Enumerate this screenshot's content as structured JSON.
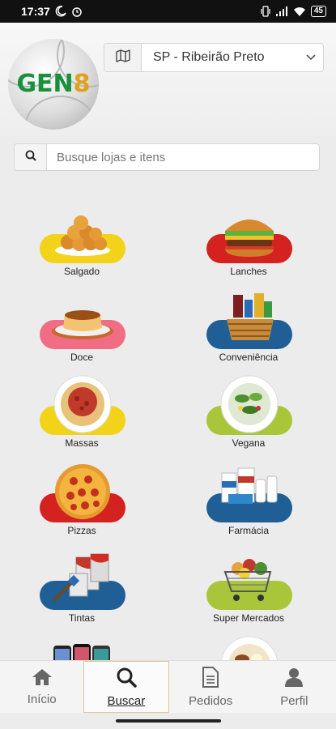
{
  "status": {
    "time": "17:37",
    "battery": "45"
  },
  "logo": {
    "text_a": "GEN",
    "text_b": "8"
  },
  "city": {
    "selected": "SP - Ribeirão Preto"
  },
  "search": {
    "placeholder": "Busque lojas e itens",
    "value": ""
  },
  "categories": [
    {
      "label": "Salgado",
      "color": "#f3d21a"
    },
    {
      "label": "Lanches",
      "color": "#d3221f"
    },
    {
      "label": "Doce",
      "color": "#f06d83"
    },
    {
      "label": "Conveniência",
      "color": "#1f5f95"
    },
    {
      "label": "Massas",
      "color": "#f3d21a"
    },
    {
      "label": "Vegana",
      "color": "#a9c63b"
    },
    {
      "label": "Pizzas",
      "color": "#d3221f"
    },
    {
      "label": "Farmácia",
      "color": "#1f5f95"
    },
    {
      "label": "Tintas",
      "color": "#1f5f95"
    },
    {
      "label": "Super Mercados",
      "color": "#a9c63b"
    },
    {
      "label": "",
      "color": "#1f5f95"
    },
    {
      "label": "",
      "color": "#d3221f"
    }
  ],
  "nav": {
    "items": [
      {
        "label": "Início",
        "icon": "home-icon"
      },
      {
        "label": "Buscar",
        "icon": "search-icon",
        "active": true
      },
      {
        "label": "Pedidos",
        "icon": "document-icon"
      },
      {
        "label": "Perfil",
        "icon": "user-icon"
      }
    ]
  }
}
